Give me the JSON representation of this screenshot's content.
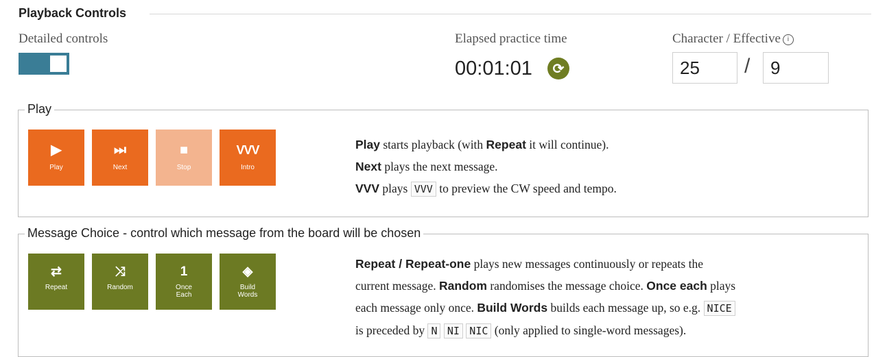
{
  "header": {
    "title": "Playback Controls"
  },
  "detailed": {
    "label": "Detailed controls",
    "on": true
  },
  "elapsed": {
    "label": "Elapsed practice time",
    "value": "00:01:01",
    "icon": "refresh-icon"
  },
  "speed": {
    "label": "Character / Effective",
    "info_icon": "ⓘ",
    "character": "25",
    "separator": "/",
    "effective": "9"
  },
  "play_section": {
    "legend": "Play",
    "buttons": [
      {
        "label": "Play",
        "icon": "▶",
        "enabled": true
      },
      {
        "label": "Next",
        "icon": "⏭",
        "enabled": true
      },
      {
        "label": "Stop",
        "icon": "■",
        "enabled": false
      },
      {
        "label": "Intro",
        "icon": "VVV",
        "enabled": true
      }
    ],
    "desc": {
      "l1_b1": "Play",
      "l1_t1": " starts playback (with ",
      "l1_b2": "Repeat",
      "l1_t2": " it will continue).",
      "l2_b1": "Next",
      "l2_t1": " plays the next message.",
      "l3_b1": "VVV",
      "l3_t1": " plays ",
      "l3_code": "VVV",
      "l3_t2": " to preview the CW speed and tempo."
    }
  },
  "message_section": {
    "legend": "Message Choice - control which message from the board will be chosen",
    "buttons": [
      {
        "label1": "Repeat",
        "label2": "",
        "icon": "⇄"
      },
      {
        "label1": "Random",
        "label2": "",
        "icon": "⤨"
      },
      {
        "label1": "Once",
        "label2": "Each",
        "icon": "1"
      },
      {
        "label1": "Build",
        "label2": "Words",
        "icon": "◈"
      }
    ],
    "desc": {
      "l1_b1": "Repeat / Repeat-one",
      "l1_t1": " plays new messages continuously or repeats the",
      "l2_t1": "current message. ",
      "l2_b1": "Random",
      "l2_t2": " randomises the message choice. ",
      "l2_b2": "Once each",
      "l2_t3": " plays",
      "l3_t1": "each message only once. ",
      "l3_b1": "Build Words",
      "l3_t2": " builds each message up, so e.g. ",
      "l3_code": "NICE",
      "l4_t1": "is preceded by ",
      "l4_code1": "N",
      "l4_code2": "NI",
      "l4_code3": "NIC",
      "l4_t2": " (only applied to single-word messages)."
    }
  },
  "colors": {
    "accent_orange": "#ea6a1f",
    "accent_olive": "#6c7a23",
    "toggle_blue": "#3a7d96"
  }
}
